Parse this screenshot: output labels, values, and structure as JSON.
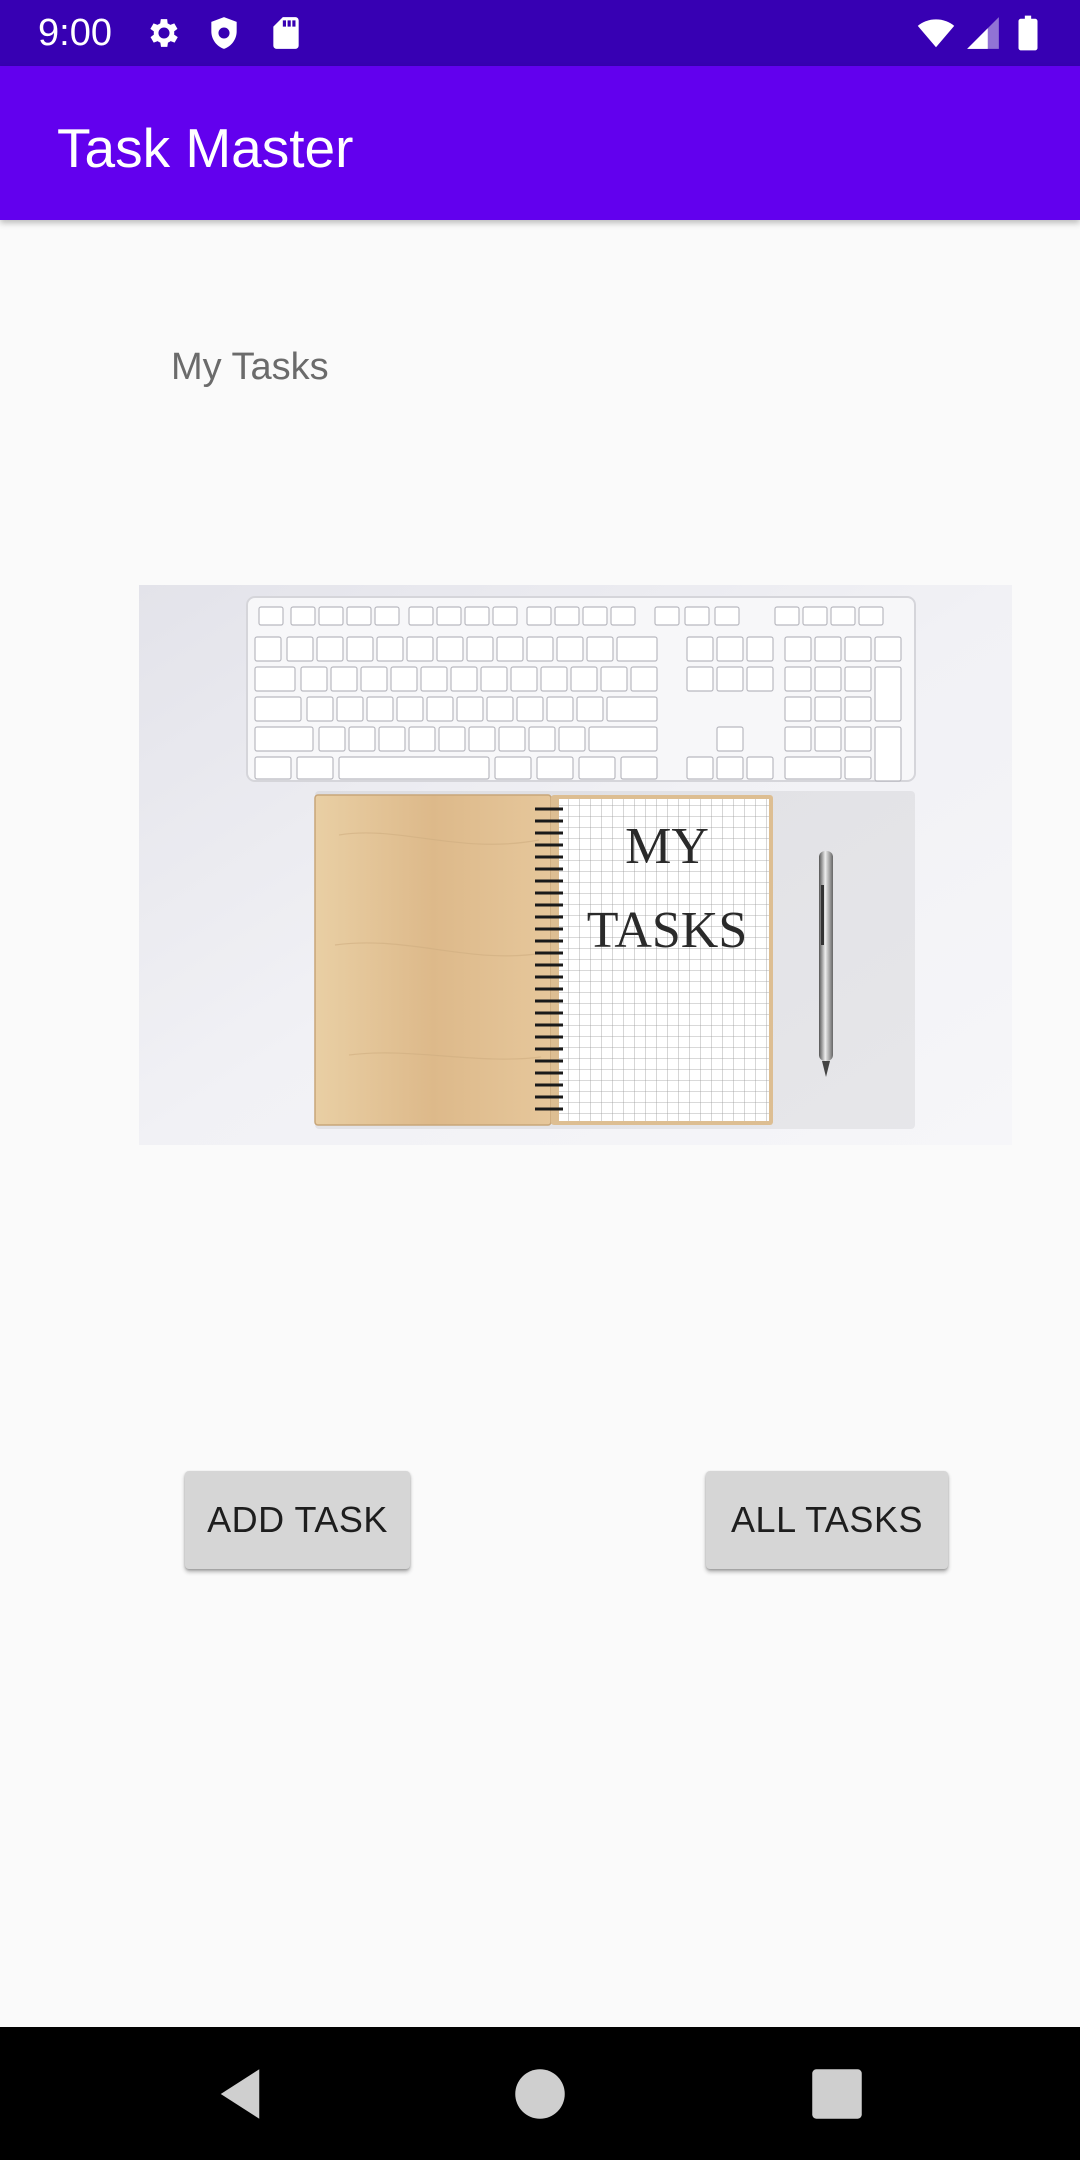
{
  "status_bar": {
    "time": "9:00",
    "icons_left": [
      "gear-icon",
      "shield-icon",
      "sd-card-icon"
    ],
    "icons_right": [
      "wifi-icon",
      "cell-signal-icon",
      "battery-icon"
    ]
  },
  "app_bar": {
    "title": "Task Master",
    "color": "#6200EE",
    "status_color": "#3700B3"
  },
  "main": {
    "heading": "My Tasks",
    "image": {
      "description_text": "MY TASKS",
      "line1": "MY",
      "line2": "TASKS"
    },
    "buttons": {
      "add_task": "ADD TASK",
      "all_tasks": "ALL TASKS"
    }
  },
  "nav_bar": {
    "buttons": [
      "back-icon",
      "home-icon",
      "recents-icon"
    ]
  }
}
